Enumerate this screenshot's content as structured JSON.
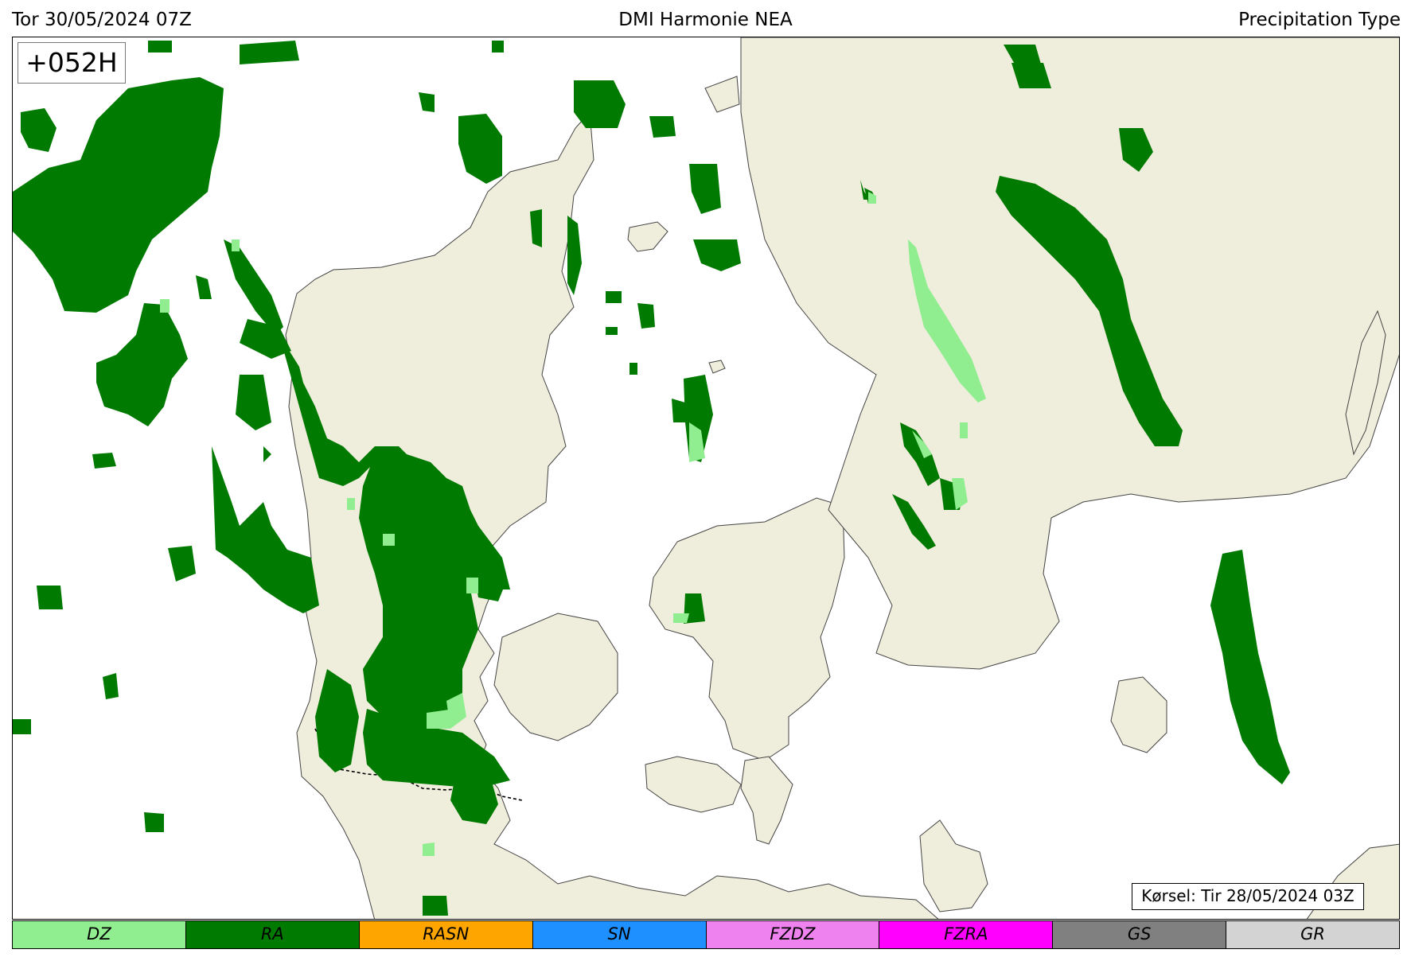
{
  "header": {
    "valid_time": "Tor 30/05/2024 07Z",
    "model": "DMI Harmonie NEA",
    "field": "Precipitation Type"
  },
  "lead_time": "+052H",
  "run_label": "Kørsel: Tir 28/05/2024 03Z",
  "colors": {
    "land": "#efeddb",
    "sea": "#ffffff",
    "coastline": "#444444",
    "border": "#000000"
  },
  "legend": [
    {
      "code": "DZ",
      "color": "#90ee90"
    },
    {
      "code": "RA",
      "color": "#007a00"
    },
    {
      "code": "RASN",
      "color": "#ffa500"
    },
    {
      "code": "SN",
      "color": "#1e90ff"
    },
    {
      "code": "FZDZ",
      "color": "#ee82ee"
    },
    {
      "code": "FZRA",
      "color": "#ff00ff"
    },
    {
      "code": "GS",
      "color": "#808080"
    },
    {
      "code": "GR",
      "color": "#d3d3d3"
    }
  ]
}
